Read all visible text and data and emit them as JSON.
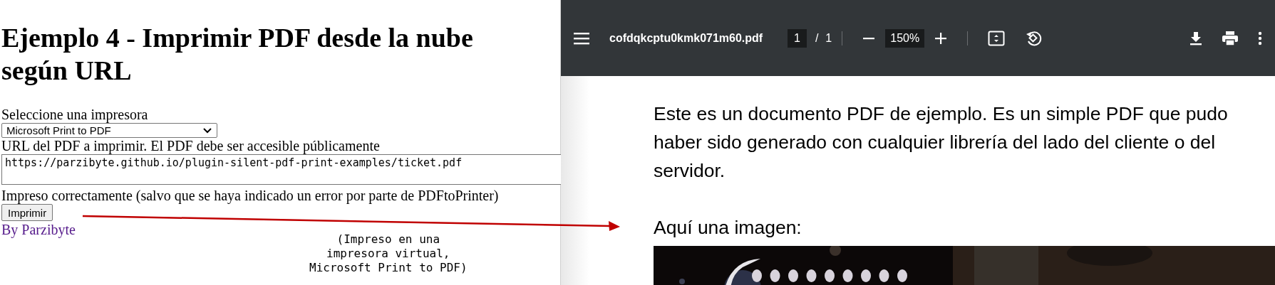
{
  "left_page": {
    "heading": "Ejemplo 4 - Imprimir PDF desde la nube según URL",
    "printer_label": "Seleccione una impresora",
    "printer_select": {
      "value": "Microsoft Print to PDF"
    },
    "url_label": "URL del PDF a imprimir. El PDF debe ser accesible públicamente",
    "url_field": {
      "value": "https://parzibyte.github.io/plugin-silent-pdf-print-examples/ticket.pdf"
    },
    "status": "Impreso correctamente (salvo que se haya indicado un error por parte de PDFtoPrinter)",
    "print_button": "Imprimir",
    "author_link": "By Parzibyte"
  },
  "annotation": {
    "note_lines": [
      "(Impreso en una",
      "impresora virtual,",
      "Microsoft Print to PDF)"
    ]
  },
  "pdf_viewer": {
    "file_name": "cofdqkcptu0kmk071m60.pdf",
    "page": "1",
    "page_separator": "/",
    "page_count": "1",
    "zoom": "150%",
    "document": {
      "paragraphs": [
        "Este es un documento PDF de ejemplo. Es un simple PDF que pudo haber sido generado con cualquier librería del lado del cliente o del servidor.",
        "Aquí una imagen:"
      ],
      "image": {
        "kind": "picture"
      }
    }
  }
}
